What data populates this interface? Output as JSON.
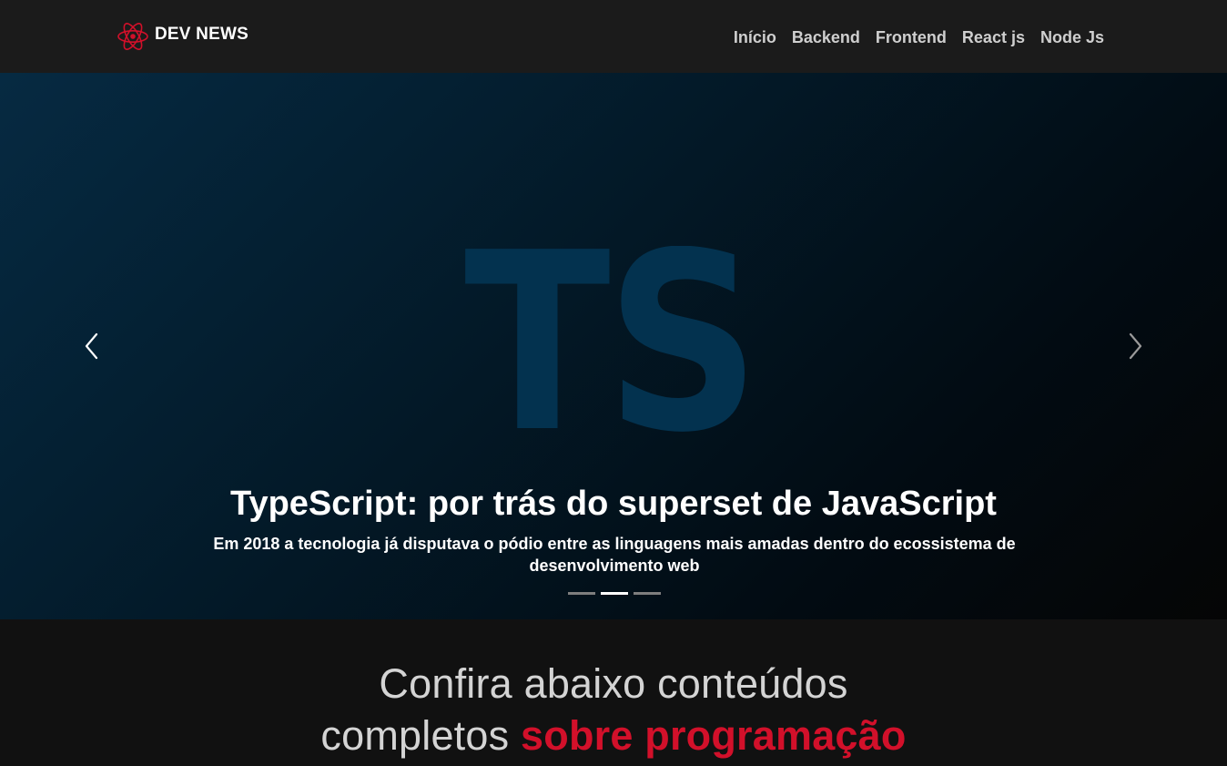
{
  "brand": {
    "name": "DEV NEWS",
    "logo_icon": "react-atom-icon",
    "logo_color": "#d2102a"
  },
  "nav": {
    "items": [
      {
        "label": "Início"
      },
      {
        "label": "Backend"
      },
      {
        "label": "Frontend"
      },
      {
        "label": "React js"
      },
      {
        "label": "Node Js"
      }
    ]
  },
  "carousel": {
    "image_text": "TS",
    "image_text_color": "#03324f",
    "title": "TypeScript: por trás do superset de JavaScript",
    "description": "Em 2018 a tecnologia já disputava o pódio entre as linguagens mais amadas dentro do ecossistema de desenvolvimento web",
    "prev_icon": "chevron-left-icon",
    "next_icon": "chevron-right-icon",
    "slide_count": 3,
    "active_slide": 2
  },
  "section": {
    "heading_line1": "Confira abaixo conteúdos",
    "heading_line2_plain": "completos ",
    "heading_line2_accent": "sobre programação",
    "accent_color": "#d2102a"
  }
}
